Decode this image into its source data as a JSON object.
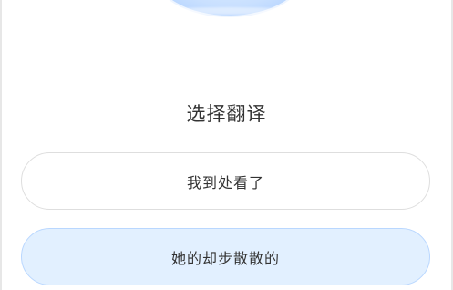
{
  "prompt": {
    "title": "选择翻译"
  },
  "options": [
    {
      "label": "我到处看了",
      "selected": false
    },
    {
      "label": "她的却步散散的",
      "selected": true
    }
  ],
  "colors": {
    "selected_bg": "#e2f0ff",
    "selected_border": "#b9d7ff",
    "option_border": "#dedede",
    "text": "#333333"
  }
}
